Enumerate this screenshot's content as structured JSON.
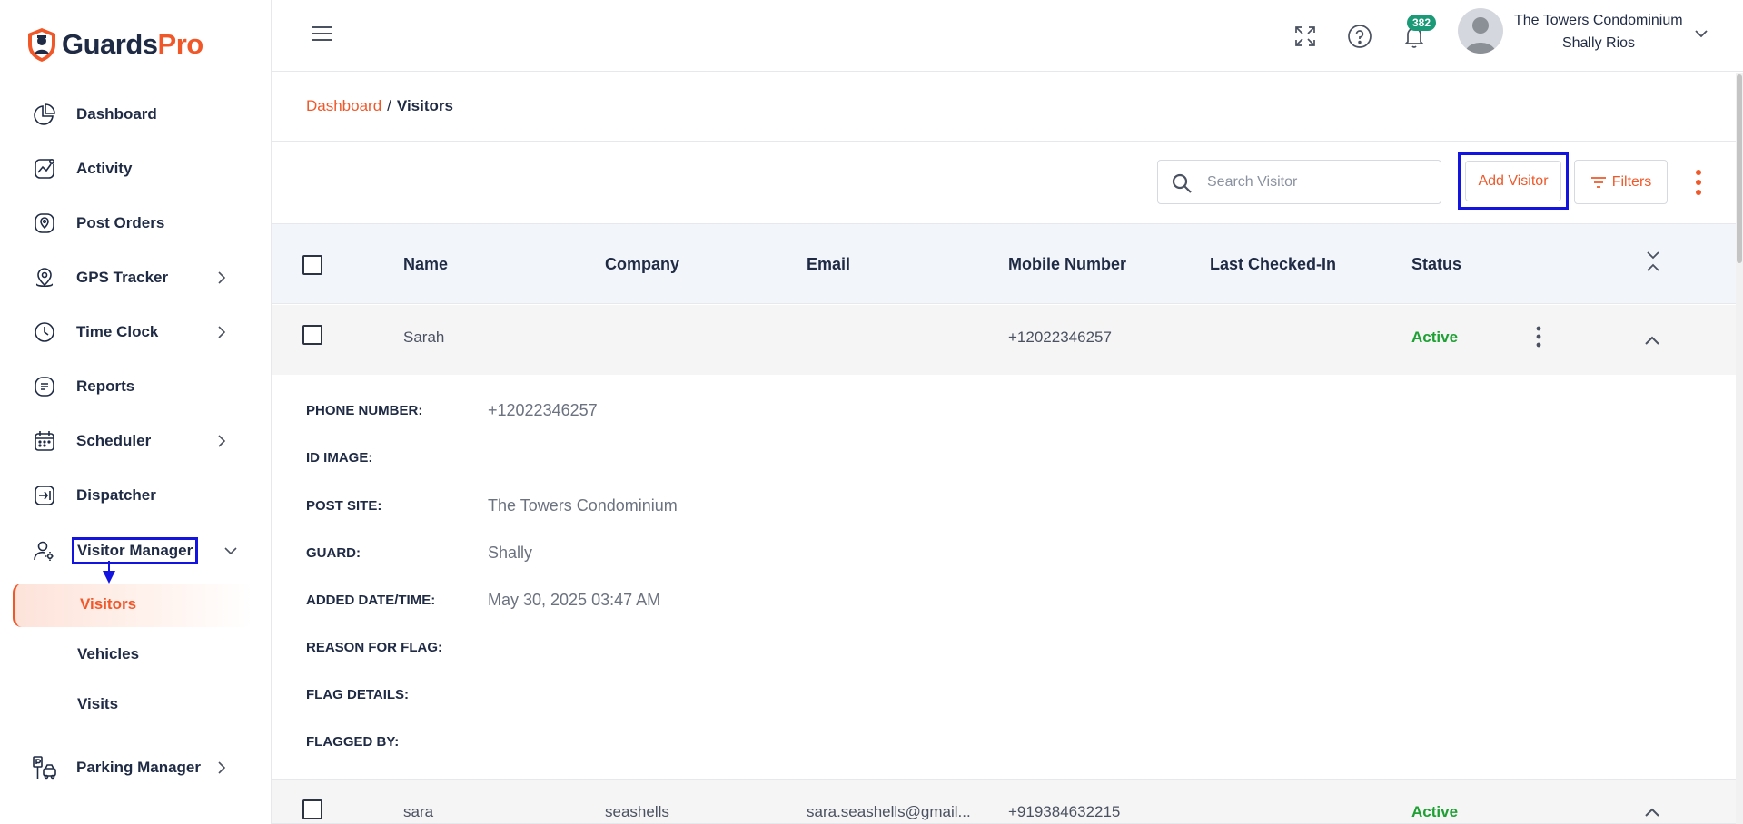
{
  "brand": {
    "part1": "Guards",
    "part2": "Pro",
    "accent": "#f0582a",
    "dark": "#1f2a44"
  },
  "sidebar": {
    "items": [
      {
        "label": "Dashboard",
        "icon": "pie-chart-icon"
      },
      {
        "label": "Activity",
        "icon": "activity-chart-icon"
      },
      {
        "label": "Post Orders",
        "icon": "post-orders-icon"
      },
      {
        "label": "GPS Tracker",
        "icon": "map-pin-icon"
      },
      {
        "label": "Time Clock",
        "icon": "clock-icon"
      },
      {
        "label": "Reports",
        "icon": "document-icon"
      },
      {
        "label": "Scheduler",
        "icon": "calendar-icon"
      },
      {
        "label": "Dispatcher",
        "icon": "dispatch-icon"
      },
      {
        "label": "Visitor Manager",
        "icon": "user-gear-icon"
      },
      {
        "label": "Parking Manager",
        "icon": "parking-icon"
      }
    ],
    "sub_items": [
      {
        "label": "Visitors",
        "active": true
      },
      {
        "label": "Vehicles"
      },
      {
        "label": "Visits"
      }
    ]
  },
  "topbar": {
    "notification_count": "382",
    "user_org": "The Towers Condominium",
    "user_name": "Shally Rios"
  },
  "breadcrumb": {
    "root": "Dashboard",
    "separator": "/",
    "current": "Visitors"
  },
  "toolbar": {
    "search_placeholder": "Search Visitor",
    "add_label": "Add Visitor",
    "filters_label": "Filters"
  },
  "table": {
    "columns": [
      "Name",
      "Company",
      "Email",
      "Mobile Number",
      "Last Checked-In",
      "Status"
    ],
    "rows": [
      {
        "name": "Sarah",
        "company": "",
        "email": "",
        "mobile": "+12022346257",
        "last_checked_in": "",
        "status": "Active"
      },
      {
        "name": "sara",
        "company": "seashells",
        "email": "sara.seashells@gmail...",
        "mobile": "+919384632215",
        "last_checked_in": "",
        "status": "Active"
      }
    ],
    "status_color": "#1ea133"
  },
  "details": {
    "labels": [
      "PHONE NUMBER:",
      "ID IMAGE:",
      "POST SITE:",
      "GUARD:",
      "ADDED DATE/TIME:",
      "REASON FOR FLAG:",
      "FLAG DETAILS:",
      "FLAGGED BY:"
    ],
    "phone": "+12022346257",
    "post_site": "The Towers Condominium",
    "guard": "Shally",
    "added": "May 30, 2025 03:47 AM"
  }
}
